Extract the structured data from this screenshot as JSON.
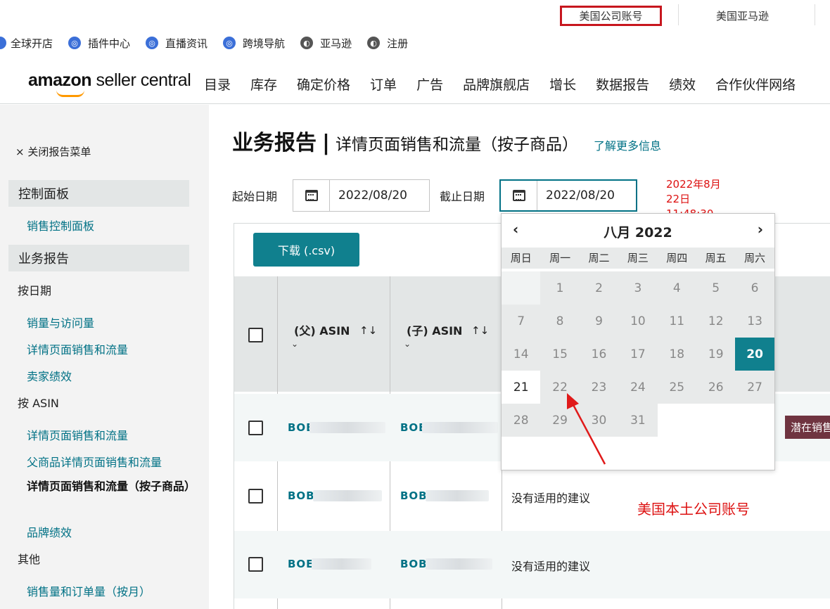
{
  "top": {
    "account_box": "美国公司账号",
    "account_right": "美国亚马逊"
  },
  "links": [
    {
      "label": "全球开店",
      "icon": "half-circle-icon"
    },
    {
      "label": "插件中心",
      "icon": "globe-blue-icon"
    },
    {
      "label": "直播资讯",
      "icon": "globe-blue-icon"
    },
    {
      "label": "跨境导航",
      "icon": "globe-blue-icon"
    },
    {
      "label": "亚马逊",
      "icon": "globe-gray-icon"
    },
    {
      "label": "注册",
      "icon": "globe-gray-icon"
    }
  ],
  "header": {
    "logo_bold": "amazon",
    "logo_light": " seller central",
    "nav": [
      "目录",
      "库存",
      "确定价格",
      "订单",
      "广告",
      "品牌旗舰店",
      "增长",
      "数据报告",
      "绩效",
      "合作伙伴网络"
    ]
  },
  "sidebar": {
    "close": "× 关闭报告菜单",
    "sections": [
      {
        "title": "控制面板"
      },
      {
        "title": "业务报告"
      }
    ],
    "dashboard_item": "销售控制面板",
    "group_by_date": "按日期",
    "by_date_items": [
      "销量与访问量",
      "详情页面销售和流量",
      "卖家绩效"
    ],
    "group_by_asin": "按 ASIN",
    "by_asin_items": [
      "详情页面销售和流量",
      "父商品详情页面销售和流量",
      "详情页面销售和流量（按子商品）",
      "品牌绩效"
    ],
    "group_other": "其他",
    "other_items": [
      "销售量和订单量（按月）"
    ]
  },
  "main": {
    "title": "业务报告",
    "subtitle": "详情页面销售和流量（按子商品）",
    "learn_more": "了解更多信息",
    "start_label": "起始日期",
    "start_value": "2022/08/20",
    "end_label": "截止日期",
    "end_value": "2022/08/20",
    "timestamp": [
      "2022年8月",
      "22日",
      "11:48:30"
    ],
    "download": "下载 (.csv)"
  },
  "table": {
    "headers": [
      "(父) ASIN",
      "(子) ASIN"
    ],
    "rows": [
      {
        "parent": "BOE",
        "child": "BOE",
        "suggestion": "",
        "tag": "潜在销售"
      },
      {
        "parent": "BOB",
        "child": "BOB",
        "suggestion": "没有适用的建议",
        "tag": ""
      },
      {
        "parent": "BOE",
        "child": "BOB",
        "suggestion": "没有适用的建议",
        "tag": ""
      }
    ]
  },
  "calendar": {
    "prev": "‹",
    "next": "›",
    "month": "八月 2022",
    "weekdays": [
      "周日",
      "周一",
      "周二",
      "周三",
      "周四",
      "周五",
      "周六"
    ],
    "days": [
      1,
      2,
      3,
      4,
      5,
      6,
      7,
      8,
      9,
      10,
      11,
      12,
      13,
      14,
      15,
      16,
      17,
      18,
      19,
      20,
      21,
      22,
      23,
      24,
      25,
      26,
      27,
      28,
      29,
      30,
      31
    ],
    "first_weekday": 1,
    "selected": 20,
    "today": 21
  },
  "annotation": "美国本土公司账号",
  "colors": {
    "teal": "#10808e",
    "link": "#007185",
    "annotation": "#dd1111"
  }
}
